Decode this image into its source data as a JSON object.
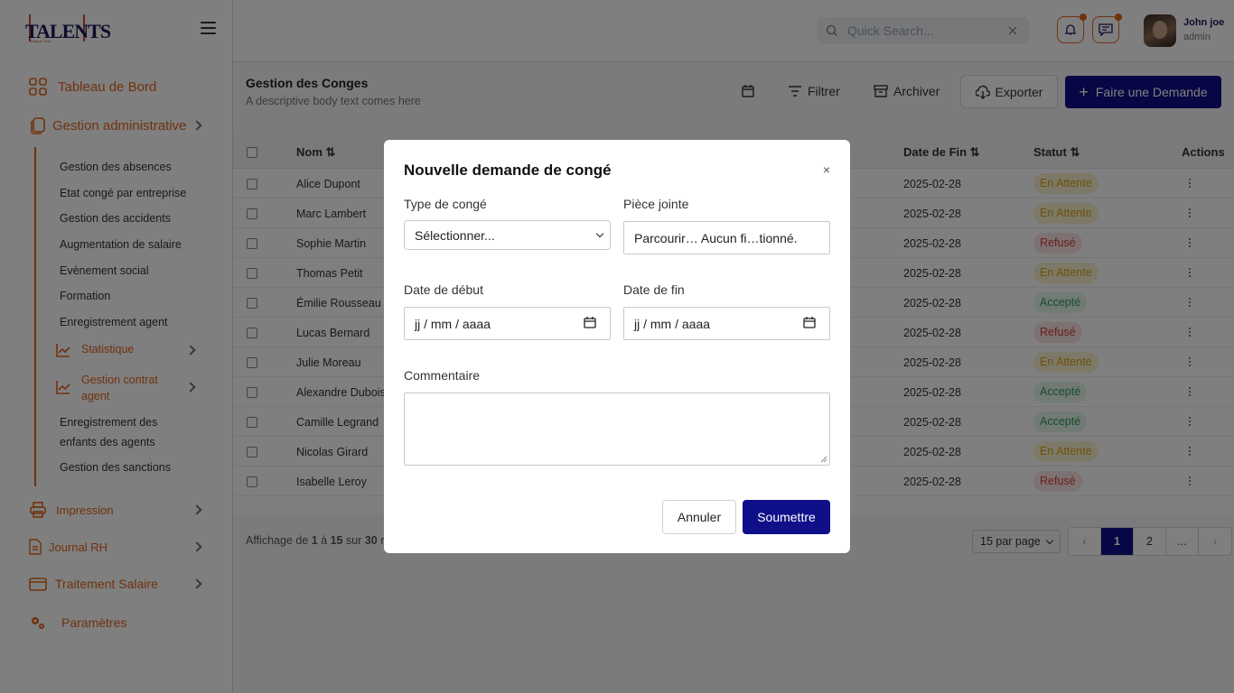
{
  "logo": {
    "word": "TALENTS",
    "tagline": "Afrique Unie"
  },
  "sidebar": {
    "dashboard": "Tableau de Bord",
    "admin": "Gestion administrative",
    "admin_items": [
      "Gestion des absences",
      "Etat congé par entreprise",
      "Gestion des accidents",
      "Augmentation de salaire",
      "Evènement social",
      "Formation",
      "Enregistrement agent"
    ],
    "statistique": "Statistique",
    "contrat_line1": "Gestion contrat",
    "contrat_line2": "agent",
    "enfants_line1": "Enregistrement des",
    "enfants_line2": "enfants des agents",
    "sanctions": "Gestion des sanctions",
    "impression": "Impression",
    "journal": "Journal RH",
    "salaire": "Traitement Salaire",
    "parametres": "Paramètres"
  },
  "header": {
    "search_placeholder": "Quick Search...",
    "user_name": "John joe",
    "user_role": "admin"
  },
  "page": {
    "title": "Gestion des Conges",
    "description": "A descriptive body text comes here",
    "filter": "Filtrer",
    "archive": "Archiver",
    "export": "Exporter",
    "new_request": "Faire une Demande"
  },
  "table": {
    "headers": {
      "name": "Nom ⇅",
      "end_date": "Date de Fin ⇅",
      "status": "Statut ⇅",
      "actions": "Actions"
    },
    "rows": [
      {
        "name": "Alice Dupont",
        "end": "2025-02-28",
        "status": "En Attente",
        "kind": "wait"
      },
      {
        "name": "Marc Lambert",
        "end": "2025-02-28",
        "status": "En Attente",
        "kind": "wait"
      },
      {
        "name": "Sophie Martin",
        "end": "2025-02-28",
        "status": "Refusé",
        "kind": "ref"
      },
      {
        "name": "Thomas Petit",
        "end": "2025-02-28",
        "status": "En Attente",
        "kind": "wait"
      },
      {
        "name": "Émilie Rousseau",
        "end": "2025-02-28",
        "status": "Accepté",
        "kind": "acc"
      },
      {
        "name": "Lucas Bernard",
        "end": "2025-02-28",
        "status": "Refusé",
        "kind": "ref"
      },
      {
        "name": "Julie Moreau",
        "end": "2025-02-28",
        "status": "En Attente",
        "kind": "wait"
      },
      {
        "name": "Alexandre Dubois",
        "end": "2025-02-28",
        "status": "Accepté",
        "kind": "acc"
      },
      {
        "name": "Camille Legrand",
        "end": "2025-02-28",
        "status": "Accepté",
        "kind": "acc"
      },
      {
        "name": "Nicolas Girard",
        "end": "2025-02-28",
        "status": "En Attente",
        "kind": "wait"
      },
      {
        "name": "Isabelle Leroy",
        "end": "2025-02-28",
        "status": "Refusé",
        "kind": "ref"
      }
    ]
  },
  "footer": {
    "showing_pre": "Affichage de ",
    "showing_from": "1",
    "showing_mid": " à ",
    "showing_to": "15",
    "showing_sur": " sur ",
    "showing_total": "30",
    "showing_tail": " r",
    "per_page": "15 par page",
    "pages": [
      "‹",
      "1",
      "2",
      "...",
      "›"
    ]
  },
  "modal": {
    "title": "Nouvelle demande de congé",
    "close": "×",
    "type_label": "Type de congé",
    "type_value": "Sélectionner...",
    "attach_label": "Pièce jointe",
    "attach_value": "Parcourir… Aucun fi…tionné.",
    "start_label": "Date de début",
    "start_value": "jj / mm / aaaa",
    "end_label": "Date de fin",
    "end_value": "jj / mm / aaaa",
    "comment_label": "Commentaire",
    "cancel": "Annuler",
    "submit": "Soumettre"
  }
}
